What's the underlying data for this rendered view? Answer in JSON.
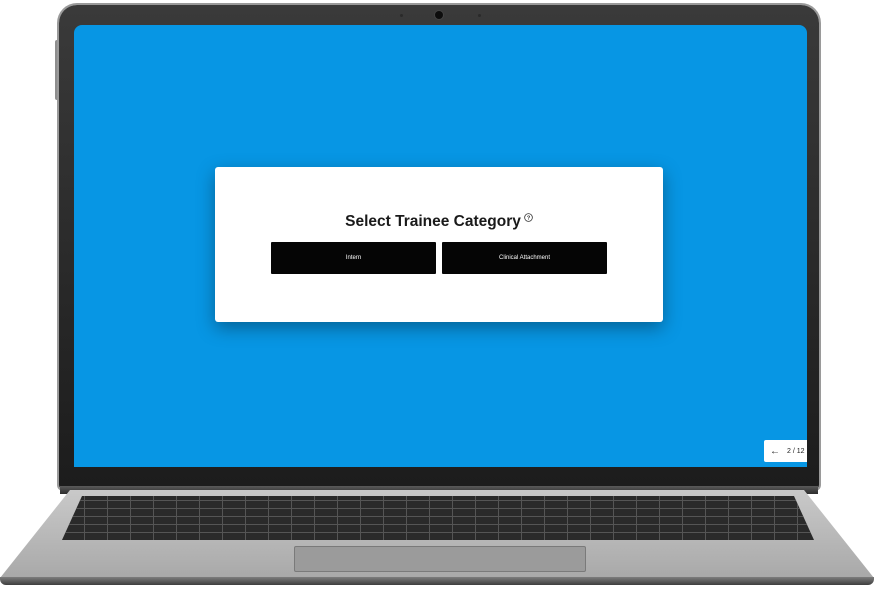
{
  "dialog": {
    "title": "Select Trainee Category",
    "help_icon": "question-circle-icon",
    "options": [
      {
        "label": "Intern"
      },
      {
        "label": "Clinical Attachment"
      }
    ]
  },
  "pager": {
    "back_icon": "arrow-left-icon",
    "count": "2 / 12"
  },
  "colors": {
    "screen_background": "#0796e4",
    "button_background": "#050505",
    "dialog_background": "#ffffff"
  }
}
